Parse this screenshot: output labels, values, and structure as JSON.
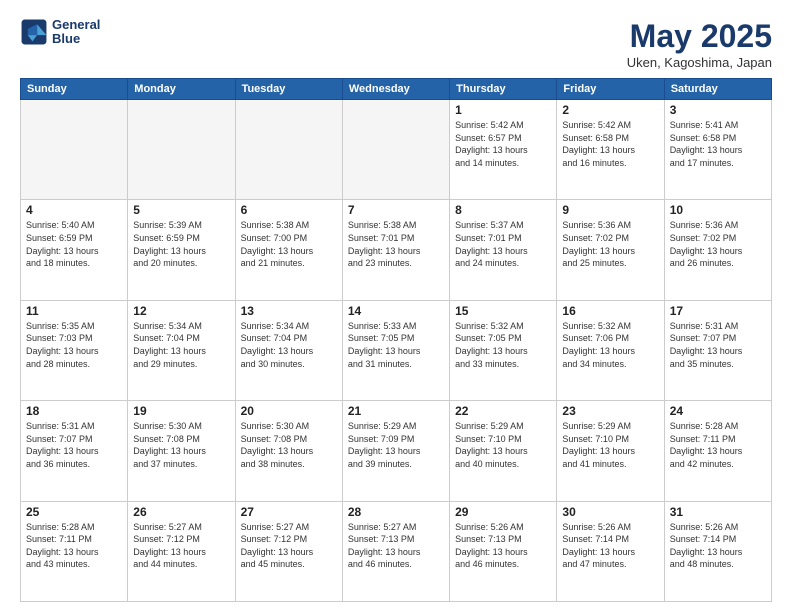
{
  "logo": {
    "line1": "General",
    "line2": "Blue"
  },
  "title": "May 2025",
  "subtitle": "Uken, Kagoshima, Japan",
  "days_header": [
    "Sunday",
    "Monday",
    "Tuesday",
    "Wednesday",
    "Thursday",
    "Friday",
    "Saturday"
  ],
  "weeks": [
    [
      {
        "day": "",
        "info": "",
        "empty": true
      },
      {
        "day": "",
        "info": "",
        "empty": true
      },
      {
        "day": "",
        "info": "",
        "empty": true
      },
      {
        "day": "",
        "info": "",
        "empty": true
      },
      {
        "day": "1",
        "info": "Sunrise: 5:42 AM\nSunset: 6:57 PM\nDaylight: 13 hours\nand 14 minutes."
      },
      {
        "day": "2",
        "info": "Sunrise: 5:42 AM\nSunset: 6:58 PM\nDaylight: 13 hours\nand 16 minutes."
      },
      {
        "day": "3",
        "info": "Sunrise: 5:41 AM\nSunset: 6:58 PM\nDaylight: 13 hours\nand 17 minutes."
      }
    ],
    [
      {
        "day": "4",
        "info": "Sunrise: 5:40 AM\nSunset: 6:59 PM\nDaylight: 13 hours\nand 18 minutes."
      },
      {
        "day": "5",
        "info": "Sunrise: 5:39 AM\nSunset: 6:59 PM\nDaylight: 13 hours\nand 20 minutes."
      },
      {
        "day": "6",
        "info": "Sunrise: 5:38 AM\nSunset: 7:00 PM\nDaylight: 13 hours\nand 21 minutes."
      },
      {
        "day": "7",
        "info": "Sunrise: 5:38 AM\nSunset: 7:01 PM\nDaylight: 13 hours\nand 23 minutes."
      },
      {
        "day": "8",
        "info": "Sunrise: 5:37 AM\nSunset: 7:01 PM\nDaylight: 13 hours\nand 24 minutes."
      },
      {
        "day": "9",
        "info": "Sunrise: 5:36 AM\nSunset: 7:02 PM\nDaylight: 13 hours\nand 25 minutes."
      },
      {
        "day": "10",
        "info": "Sunrise: 5:36 AM\nSunset: 7:02 PM\nDaylight: 13 hours\nand 26 minutes."
      }
    ],
    [
      {
        "day": "11",
        "info": "Sunrise: 5:35 AM\nSunset: 7:03 PM\nDaylight: 13 hours\nand 28 minutes."
      },
      {
        "day": "12",
        "info": "Sunrise: 5:34 AM\nSunset: 7:04 PM\nDaylight: 13 hours\nand 29 minutes."
      },
      {
        "day": "13",
        "info": "Sunrise: 5:34 AM\nSunset: 7:04 PM\nDaylight: 13 hours\nand 30 minutes."
      },
      {
        "day": "14",
        "info": "Sunrise: 5:33 AM\nSunset: 7:05 PM\nDaylight: 13 hours\nand 31 minutes."
      },
      {
        "day": "15",
        "info": "Sunrise: 5:32 AM\nSunset: 7:05 PM\nDaylight: 13 hours\nand 33 minutes."
      },
      {
        "day": "16",
        "info": "Sunrise: 5:32 AM\nSunset: 7:06 PM\nDaylight: 13 hours\nand 34 minutes."
      },
      {
        "day": "17",
        "info": "Sunrise: 5:31 AM\nSunset: 7:07 PM\nDaylight: 13 hours\nand 35 minutes."
      }
    ],
    [
      {
        "day": "18",
        "info": "Sunrise: 5:31 AM\nSunset: 7:07 PM\nDaylight: 13 hours\nand 36 minutes."
      },
      {
        "day": "19",
        "info": "Sunrise: 5:30 AM\nSunset: 7:08 PM\nDaylight: 13 hours\nand 37 minutes."
      },
      {
        "day": "20",
        "info": "Sunrise: 5:30 AM\nSunset: 7:08 PM\nDaylight: 13 hours\nand 38 minutes."
      },
      {
        "day": "21",
        "info": "Sunrise: 5:29 AM\nSunset: 7:09 PM\nDaylight: 13 hours\nand 39 minutes."
      },
      {
        "day": "22",
        "info": "Sunrise: 5:29 AM\nSunset: 7:10 PM\nDaylight: 13 hours\nand 40 minutes."
      },
      {
        "day": "23",
        "info": "Sunrise: 5:29 AM\nSunset: 7:10 PM\nDaylight: 13 hours\nand 41 minutes."
      },
      {
        "day": "24",
        "info": "Sunrise: 5:28 AM\nSunset: 7:11 PM\nDaylight: 13 hours\nand 42 minutes."
      }
    ],
    [
      {
        "day": "25",
        "info": "Sunrise: 5:28 AM\nSunset: 7:11 PM\nDaylight: 13 hours\nand 43 minutes."
      },
      {
        "day": "26",
        "info": "Sunrise: 5:27 AM\nSunset: 7:12 PM\nDaylight: 13 hours\nand 44 minutes."
      },
      {
        "day": "27",
        "info": "Sunrise: 5:27 AM\nSunset: 7:12 PM\nDaylight: 13 hours\nand 45 minutes."
      },
      {
        "day": "28",
        "info": "Sunrise: 5:27 AM\nSunset: 7:13 PM\nDaylight: 13 hours\nand 46 minutes."
      },
      {
        "day": "29",
        "info": "Sunrise: 5:26 AM\nSunset: 7:13 PM\nDaylight: 13 hours\nand 46 minutes."
      },
      {
        "day": "30",
        "info": "Sunrise: 5:26 AM\nSunset: 7:14 PM\nDaylight: 13 hours\nand 47 minutes."
      },
      {
        "day": "31",
        "info": "Sunrise: 5:26 AM\nSunset: 7:14 PM\nDaylight: 13 hours\nand 48 minutes."
      }
    ]
  ]
}
